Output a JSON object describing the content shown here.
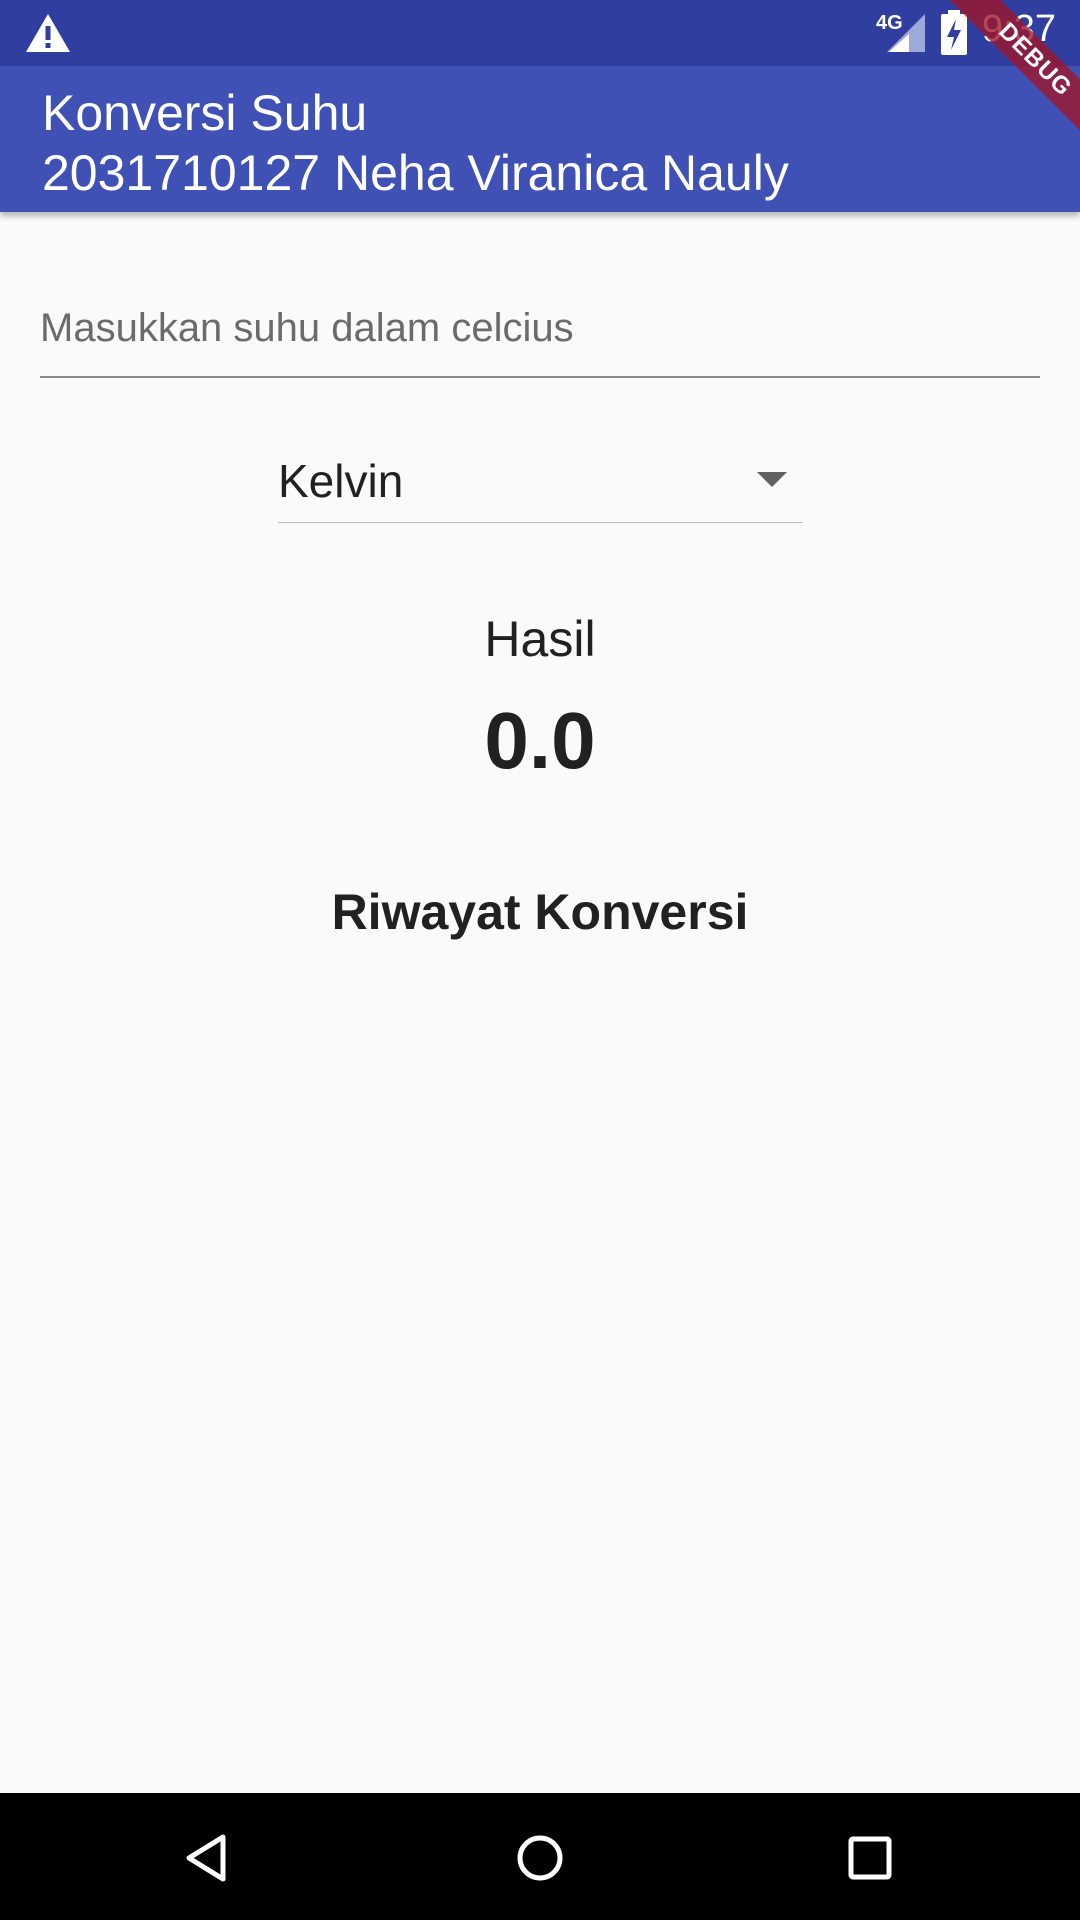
{
  "status_bar": {
    "network_label": "4G",
    "clock": "9:37",
    "icons": [
      "warning-icon",
      "cell-signal-icon",
      "battery-charging-icon"
    ]
  },
  "app_bar": {
    "title_line_1": "Konversi Suhu",
    "title_line_2": "2031710127 Neha Viranica Nauly",
    "color": "#3f51b5"
  },
  "debug_banner": {
    "label": "DEBUG",
    "color": "#a01428"
  },
  "form": {
    "celsius_input": {
      "value": "",
      "placeholder": "Masukkan suhu dalam celcius"
    },
    "unit_dropdown": {
      "selected": "Kelvin"
    }
  },
  "result": {
    "label": "Hasil",
    "value": "0.0"
  },
  "history": {
    "heading": "Riwayat Konversi",
    "items": []
  },
  "nav_bar": {
    "icons": [
      "back-icon",
      "home-icon",
      "recents-icon"
    ]
  },
  "colors": {
    "status_bar": "#303f9f",
    "background": "#fafafa",
    "text": "#212121"
  }
}
